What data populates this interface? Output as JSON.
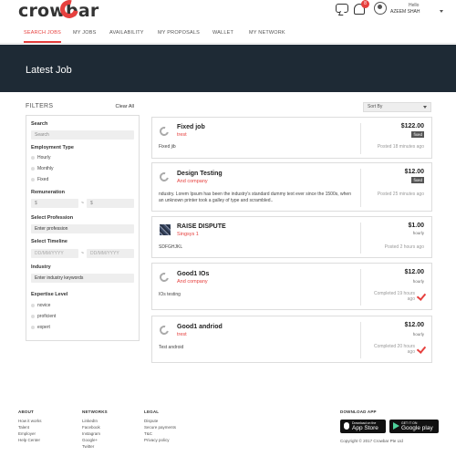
{
  "brand": {
    "name": "crowbar",
    "accent": "#e6403e",
    "banner_color": "#1e2a35"
  },
  "header": {
    "hello": "Hello",
    "username": "AZEEM SHAH",
    "notification_count": "8"
  },
  "nav": [
    {
      "label": "SEARCH JOBS",
      "active": true
    },
    {
      "label": "MY JOBS"
    },
    {
      "label": "AVAILABILITY"
    },
    {
      "label": "MY PROPOSALS"
    },
    {
      "label": "WALLET"
    },
    {
      "label": "MY NETWORK"
    }
  ],
  "banner": {
    "title": "Latest Job"
  },
  "filters": {
    "title": "FILTERS",
    "clear_all": "Clear All",
    "search_label": "Search",
    "search_placeholder": "Search",
    "employment_label": "Employment Type",
    "employment_options": [
      "Hourly",
      "Monthly",
      "Fixed"
    ],
    "remuneration_label": "Remuneration",
    "rem_min": "$",
    "rem_max": "$",
    "rem_sep": "~",
    "profession_label": "Select Profession",
    "profession_placeholder": "Enter profession",
    "timeline_label": "Select Timeline",
    "date_from": "DD/MM/YYYY",
    "date_to": "DD/MM/YYYY",
    "date_sep": "~",
    "industry_label": "Industry",
    "industry_placeholder": "Enter industry keywords",
    "expertise_label": "Expertise Level",
    "expertise_options": [
      "novice",
      "proficient",
      "expert"
    ]
  },
  "sort": {
    "label": "Sort By"
  },
  "jobs": [
    {
      "title": "Fixed job",
      "company": "trest",
      "desc": "Fixed jib",
      "price": "$122.00",
      "type": "fixed",
      "status": "Posted 18 minutes ago"
    },
    {
      "title": "Design Testing",
      "company": "And company",
      "desc": "ndustry. Lorem Ipsum has been the industry's standard dummy text ever since the 1500s, when an unknown printer took a galley of type and scrambled..",
      "price": "$12.00",
      "type": "fixed",
      "status": "Posted 25 minutes ago"
    },
    {
      "title": "RAISE DISPUTE",
      "company": "Singsys 1",
      "desc": "SDFGHJKL",
      "price": "$1.00",
      "type": "hourly",
      "status": "Posted 2 hours ago"
    },
    {
      "title": "Good1 IOs",
      "company": "And company",
      "desc": "IOs testing",
      "price": "$12.00",
      "type": "hourly",
      "status": "Completed 19 hours ago"
    },
    {
      "title": "Good1 andriod",
      "company": "trest",
      "desc": "Test android",
      "price": "$12.00",
      "type": "hourly",
      "status": "Completed 20 hours ago"
    }
  ],
  "footer": {
    "about_title": "ABOUT",
    "about_links": [
      "How it works",
      "Talent",
      "Employer",
      "Help Center"
    ],
    "networks_title": "NETWORKS",
    "networks_links": [
      "LinkedIn",
      "Facebook",
      "Instagram",
      "Google+",
      "Twitter"
    ],
    "legal_title": "LEGAL",
    "legal_links": [
      "Dispute",
      "Secure payments",
      "T&C",
      "Privacy policy"
    ],
    "download_title": "DOWNLOAD APP",
    "appstore_small": "Download on the",
    "appstore_big": "App Store",
    "play_small": "GET IT ON",
    "play_big": "Google play",
    "copyright": "Copyright © 2017 Crowbar Pte Ltd"
  }
}
